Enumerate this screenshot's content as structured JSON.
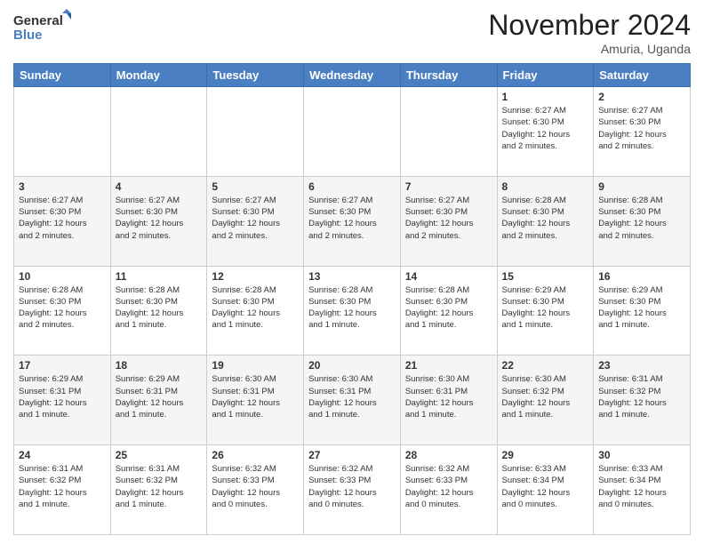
{
  "logo": {
    "line1": "General",
    "line2": "Blue"
  },
  "title": "November 2024",
  "location": "Amuria, Uganda",
  "days_of_week": [
    "Sunday",
    "Monday",
    "Tuesday",
    "Wednesday",
    "Thursday",
    "Friday",
    "Saturday"
  ],
  "weeks": [
    [
      {
        "day": "",
        "info": ""
      },
      {
        "day": "",
        "info": ""
      },
      {
        "day": "",
        "info": ""
      },
      {
        "day": "",
        "info": ""
      },
      {
        "day": "",
        "info": ""
      },
      {
        "day": "1",
        "info": "Sunrise: 6:27 AM\nSunset: 6:30 PM\nDaylight: 12 hours\nand 2 minutes."
      },
      {
        "day": "2",
        "info": "Sunrise: 6:27 AM\nSunset: 6:30 PM\nDaylight: 12 hours\nand 2 minutes."
      }
    ],
    [
      {
        "day": "3",
        "info": "Sunrise: 6:27 AM\nSunset: 6:30 PM\nDaylight: 12 hours\nand 2 minutes."
      },
      {
        "day": "4",
        "info": "Sunrise: 6:27 AM\nSunset: 6:30 PM\nDaylight: 12 hours\nand 2 minutes."
      },
      {
        "day": "5",
        "info": "Sunrise: 6:27 AM\nSunset: 6:30 PM\nDaylight: 12 hours\nand 2 minutes."
      },
      {
        "day": "6",
        "info": "Sunrise: 6:27 AM\nSunset: 6:30 PM\nDaylight: 12 hours\nand 2 minutes."
      },
      {
        "day": "7",
        "info": "Sunrise: 6:27 AM\nSunset: 6:30 PM\nDaylight: 12 hours\nand 2 minutes."
      },
      {
        "day": "8",
        "info": "Sunrise: 6:28 AM\nSunset: 6:30 PM\nDaylight: 12 hours\nand 2 minutes."
      },
      {
        "day": "9",
        "info": "Sunrise: 6:28 AM\nSunset: 6:30 PM\nDaylight: 12 hours\nand 2 minutes."
      }
    ],
    [
      {
        "day": "10",
        "info": "Sunrise: 6:28 AM\nSunset: 6:30 PM\nDaylight: 12 hours\nand 2 minutes."
      },
      {
        "day": "11",
        "info": "Sunrise: 6:28 AM\nSunset: 6:30 PM\nDaylight: 12 hours\nand 1 minute."
      },
      {
        "day": "12",
        "info": "Sunrise: 6:28 AM\nSunset: 6:30 PM\nDaylight: 12 hours\nand 1 minute."
      },
      {
        "day": "13",
        "info": "Sunrise: 6:28 AM\nSunset: 6:30 PM\nDaylight: 12 hours\nand 1 minute."
      },
      {
        "day": "14",
        "info": "Sunrise: 6:28 AM\nSunset: 6:30 PM\nDaylight: 12 hours\nand 1 minute."
      },
      {
        "day": "15",
        "info": "Sunrise: 6:29 AM\nSunset: 6:30 PM\nDaylight: 12 hours\nand 1 minute."
      },
      {
        "day": "16",
        "info": "Sunrise: 6:29 AM\nSunset: 6:30 PM\nDaylight: 12 hours\nand 1 minute."
      }
    ],
    [
      {
        "day": "17",
        "info": "Sunrise: 6:29 AM\nSunset: 6:31 PM\nDaylight: 12 hours\nand 1 minute."
      },
      {
        "day": "18",
        "info": "Sunrise: 6:29 AM\nSunset: 6:31 PM\nDaylight: 12 hours\nand 1 minute."
      },
      {
        "day": "19",
        "info": "Sunrise: 6:30 AM\nSunset: 6:31 PM\nDaylight: 12 hours\nand 1 minute."
      },
      {
        "day": "20",
        "info": "Sunrise: 6:30 AM\nSunset: 6:31 PM\nDaylight: 12 hours\nand 1 minute."
      },
      {
        "day": "21",
        "info": "Sunrise: 6:30 AM\nSunset: 6:31 PM\nDaylight: 12 hours\nand 1 minute."
      },
      {
        "day": "22",
        "info": "Sunrise: 6:30 AM\nSunset: 6:32 PM\nDaylight: 12 hours\nand 1 minute."
      },
      {
        "day": "23",
        "info": "Sunrise: 6:31 AM\nSunset: 6:32 PM\nDaylight: 12 hours\nand 1 minute."
      }
    ],
    [
      {
        "day": "24",
        "info": "Sunrise: 6:31 AM\nSunset: 6:32 PM\nDaylight: 12 hours\nand 1 minute."
      },
      {
        "day": "25",
        "info": "Sunrise: 6:31 AM\nSunset: 6:32 PM\nDaylight: 12 hours\nand 1 minute."
      },
      {
        "day": "26",
        "info": "Sunrise: 6:32 AM\nSunset: 6:33 PM\nDaylight: 12 hours\nand 0 minutes."
      },
      {
        "day": "27",
        "info": "Sunrise: 6:32 AM\nSunset: 6:33 PM\nDaylight: 12 hours\nand 0 minutes."
      },
      {
        "day": "28",
        "info": "Sunrise: 6:32 AM\nSunset: 6:33 PM\nDaylight: 12 hours\nand 0 minutes."
      },
      {
        "day": "29",
        "info": "Sunrise: 6:33 AM\nSunset: 6:34 PM\nDaylight: 12 hours\nand 0 minutes."
      },
      {
        "day": "30",
        "info": "Sunrise: 6:33 AM\nSunset: 6:34 PM\nDaylight: 12 hours\nand 0 minutes."
      }
    ]
  ]
}
